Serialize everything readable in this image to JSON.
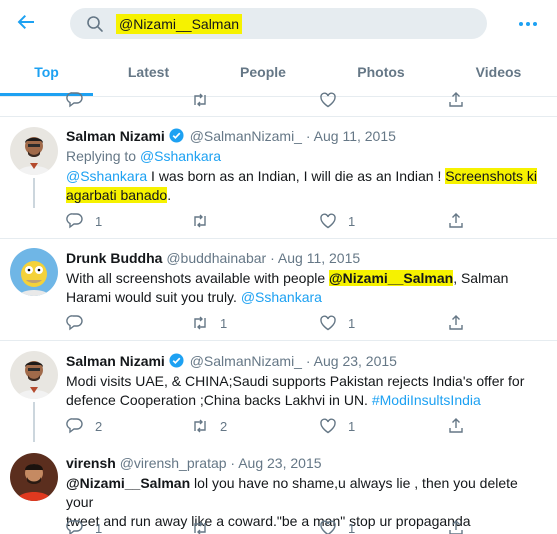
{
  "search": {
    "query": "@Nizami__Salman"
  },
  "tabs": [
    {
      "label": "Top",
      "active": true
    },
    {
      "label": "Latest",
      "active": false
    },
    {
      "label": "People",
      "active": false
    },
    {
      "label": "Photos",
      "active": false
    },
    {
      "label": "Videos",
      "active": false
    }
  ],
  "colors": {
    "accent": "#1da1f2",
    "highlight": "#f6f200",
    "muted": "#657786"
  },
  "tweets": [
    {
      "name": "Salman Nizami",
      "verified": true,
      "handle": "@SalmanNizami_",
      "sep": "·",
      "date": "Aug 11, 2015",
      "replying_prefix": "Replying to ",
      "replying_handle": "@Sshankara",
      "text_mention": "@Sshankara",
      "text_plain": " I was born as an Indian, I will die as an Indian ! ",
      "text_highlight_1": "Screenshots ki",
      "text_highlight_2": "agarbati banado",
      "text_end": ".",
      "replies": "1",
      "retweets": "",
      "likes": "1"
    },
    {
      "name": "Drunk Buddha",
      "verified": false,
      "handle": "@buddhainabar",
      "sep": "·",
      "date": "Aug 11, 2015",
      "text_plain": "With all screenshots available with people ",
      "text_mention_hl": "@Nizami__Salman",
      "text_plain_2": ", Salman",
      "text_line2": "Harami would suit you truly. ",
      "text_mention_end": "@Sshankara",
      "replies": "",
      "retweets": "1",
      "likes": "1"
    },
    {
      "name": "Salman Nizami",
      "verified": true,
      "handle": "@SalmanNizami_",
      "sep": "·",
      "date": "Aug 23, 2015",
      "text_line1": "Modi visits UAE, & CHINA;Saudi supports Pakistan rejects India's offer for",
      "text_line2": "defence Cooperation ;China backs Lakhvi in UN. ",
      "text_hashtag": "#ModiInsultsIndia",
      "replies": "2",
      "retweets": "2",
      "likes": "1"
    },
    {
      "name": "virensh",
      "verified": false,
      "handle": "@virensh_pratap",
      "sep": "·",
      "date": "Aug 23, 2015",
      "text_mention": "@Nizami__Salman",
      "text_line1": " lol you have no shame,u always lie , then you delete your",
      "text_line2": "tweet and run away like a coward.\"be a man\" stop ur propaganda",
      "replies": "1",
      "retweets": "",
      "likes": "1"
    }
  ]
}
